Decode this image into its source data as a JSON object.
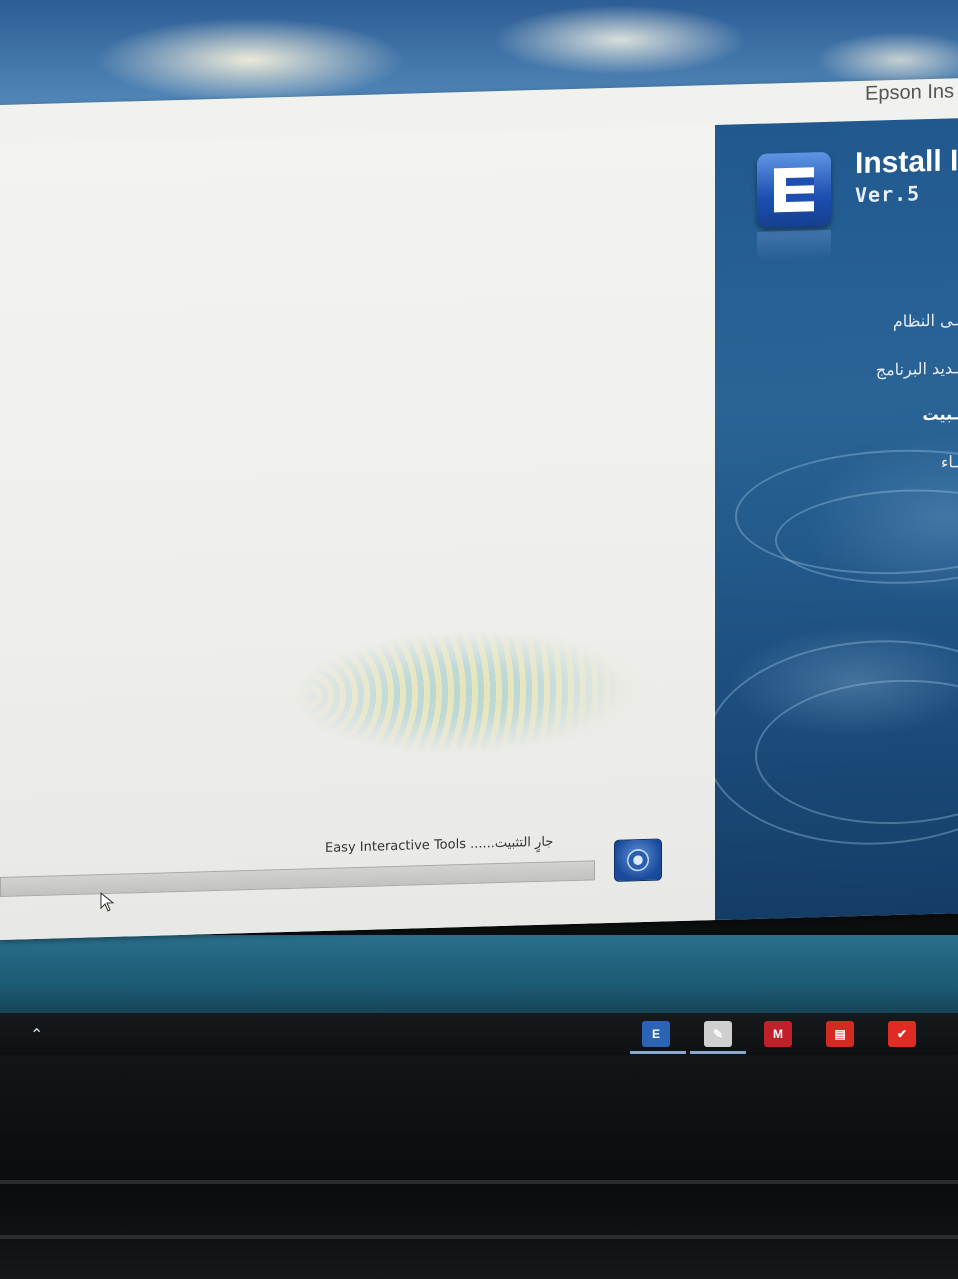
{
  "window": {
    "title": "Epson Ins"
  },
  "installer": {
    "panel_title": "Install I",
    "version": "Ver.5",
    "steps": [
      {
        "label": "ـى النظام",
        "active": false
      },
      {
        "label": "ـديد البرنامج",
        "active": false
      },
      {
        "label": "ـبيت",
        "active": true
      },
      {
        "label": "ـاء",
        "active": false
      }
    ]
  },
  "progress": {
    "status_text": "Easy Interactive Tools ......جارٍ التثبيت",
    "fraction": 0.0
  },
  "taskbar": {
    "icons": [
      {
        "name": "epson-installer-taskbar-icon",
        "label": "E",
        "color": "#2b63b5"
      },
      {
        "name": "image-viewer-taskbar-icon",
        "label": "",
        "color": "#cfcfcf"
      },
      {
        "name": "mcafee-taskbar-icon",
        "label": "M",
        "color": "#c0202a"
      },
      {
        "name": "acrobat-taskbar-icon",
        "label": "",
        "color": "#d42a1f"
      },
      {
        "name": "pdf-taskbar-icon",
        "label": "",
        "color": "#e02b22"
      }
    ]
  }
}
